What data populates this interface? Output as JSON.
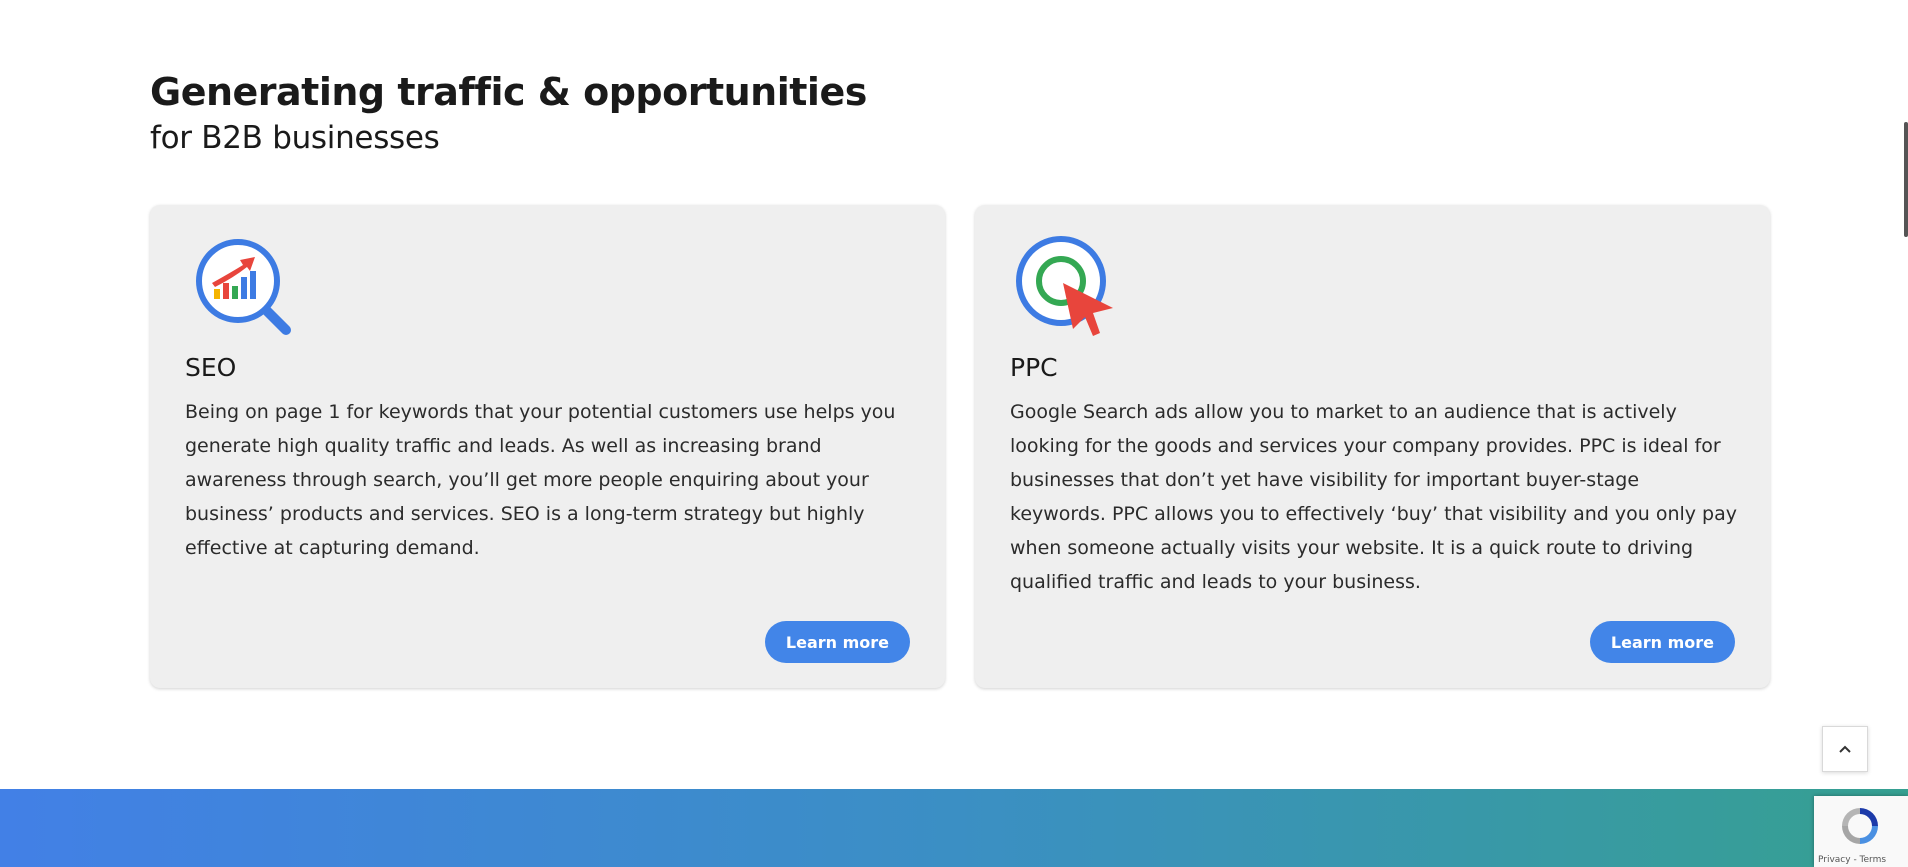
{
  "section": {
    "title": "Generating traffic & opportunities",
    "subtitle": "for B2B businesses"
  },
  "cards": [
    {
      "title": "SEO",
      "icon": "seo-magnifier-chart-icon",
      "description": "Being on page 1 for keywords that your potential customers use helps you generate high quality traffic and leads. As well as increasing brand awareness through search, you’ll get more people enquiring about your business’ products and services.  SEO is a long-term strategy but highly effective at capturing demand.",
      "button_label": "Learn more"
    },
    {
      "title": "PPC",
      "icon": "ppc-target-cursor-icon",
      "description": "Google Search ads allow you to market to an audience that is actively looking for the goods and services your company provides. PPC is ideal for businesses that don’t yet have visibility for important buyer-stage keywords. PPC allows you to effectively ‘buy’ that visibility and you only pay when someone actually visits your website. It is a quick route to driving qualified traffic and leads to your business.",
      "button_label": "Learn more"
    }
  ],
  "scroll_top": {
    "icon": "chevron-up-icon"
  },
  "recaptcha": {
    "links": "Privacy - Terms"
  },
  "colors": {
    "accent": "#4285e8",
    "card_bg": "#efefef",
    "banner_start": "#4280e6",
    "banner_end": "#36a091"
  }
}
